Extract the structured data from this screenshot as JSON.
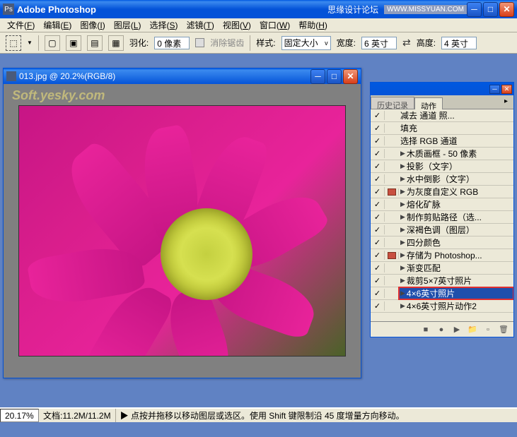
{
  "app": {
    "title": "Adobe Photoshop",
    "extra_text": "思缘设计论坛",
    "url_tag": "WWW.MISSYUAN.COM"
  },
  "menu": {
    "file": "文件",
    "file_key": "F",
    "edit": "编辑",
    "edit_key": "E",
    "image": "图像",
    "image_key": "I",
    "layer": "图层",
    "layer_key": "L",
    "select": "选择",
    "select_key": "S",
    "filter": "滤镜",
    "filter_key": "T",
    "view": "视图",
    "view_key": "V",
    "window": "窗口",
    "window_key": "W",
    "help": "帮助",
    "help_key": "H"
  },
  "options": {
    "feather_label": "羽化:",
    "feather_value": "0 像素",
    "antialias_label": "消除锯齿",
    "style_label": "样式:",
    "style_value": "固定大小",
    "width_label": "宽度:",
    "width_value": "6 英寸",
    "height_label": "高度:",
    "height_value": "4 英寸"
  },
  "document": {
    "title": "013.jpg @ 20.2%(RGB/8)",
    "watermark": "Soft.yesky.com"
  },
  "panel": {
    "tab_history": "历史记录",
    "tab_actions": "动作",
    "actions": [
      {
        "checked": true,
        "dlg": false,
        "indent": 2,
        "expand": "",
        "label": "减去 通道  照..."
      },
      {
        "checked": true,
        "dlg": false,
        "indent": 2,
        "expand": "",
        "label": "填充"
      },
      {
        "checked": true,
        "dlg": false,
        "indent": 2,
        "expand": "",
        "label": "选择 RGB 通道"
      },
      {
        "checked": true,
        "dlg": false,
        "indent": 1,
        "expand": "▶",
        "label": "木质画框 - 50 像素"
      },
      {
        "checked": true,
        "dlg": false,
        "indent": 1,
        "expand": "▶",
        "label": "投影（文字）"
      },
      {
        "checked": true,
        "dlg": false,
        "indent": 1,
        "expand": "▶",
        "label": "水中倒影（文字）"
      },
      {
        "checked": true,
        "dlg": true,
        "indent": 1,
        "expand": "▶",
        "label": "为灰度自定义 RGB"
      },
      {
        "checked": true,
        "dlg": false,
        "indent": 1,
        "expand": "▶",
        "label": "熔化矿脉"
      },
      {
        "checked": true,
        "dlg": false,
        "indent": 1,
        "expand": "▶",
        "label": "制作剪贴路径（选..."
      },
      {
        "checked": true,
        "dlg": false,
        "indent": 1,
        "expand": "▶",
        "label": "深褐色调（图层）"
      },
      {
        "checked": true,
        "dlg": false,
        "indent": 1,
        "expand": "▶",
        "label": "四分颜色"
      },
      {
        "checked": true,
        "dlg": true,
        "indent": 1,
        "expand": "▶",
        "label": "存储为 Photoshop..."
      },
      {
        "checked": true,
        "dlg": false,
        "indent": 1,
        "expand": "▶",
        "label": "渐变匹配"
      },
      {
        "checked": true,
        "dlg": false,
        "indent": 1,
        "expand": "▶",
        "label": "裁剪5×7英寸照片"
      },
      {
        "checked": true,
        "dlg": false,
        "indent": 1,
        "expand": "▶",
        "label": "4×6英寸照片",
        "highlighted": true
      },
      {
        "checked": true,
        "dlg": false,
        "indent": 1,
        "expand": "▶",
        "label": "4×6英寸照片动作2"
      }
    ]
  },
  "status": {
    "zoom": "20.17%",
    "docsize_label": "文档:",
    "docsize_value": "11.2M/11.2M",
    "hint": "▶ 点按并拖移以移动图层或选区。使用 Shift 键限制沿 45 度增量方向移动。"
  }
}
